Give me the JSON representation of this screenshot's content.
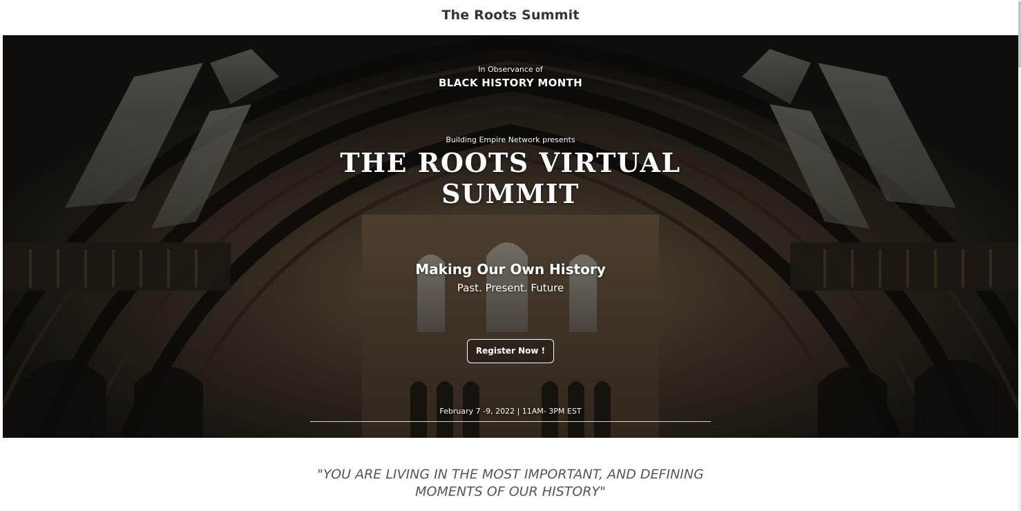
{
  "header": {
    "site_title": "The Roots Summit"
  },
  "hero": {
    "observance_pre": "In Observance of",
    "observance_main": "BLACK HISTORY MONTH",
    "presenter": "Building Empire Network presents",
    "title_line1": "THE ROOTS VIRTUAL",
    "title_line2": "SUMMIT",
    "tagline": "Making Our Own History",
    "tagline_sub": "Past. Present. Future",
    "register_label": "Register Now !",
    "event_date": "February 7 -9, 2022 | 11AM- 3PM EST"
  },
  "quote": {
    "line1": "\"YOU ARE LIVING IN THE MOST IMPORTANT, AND DEFINING",
    "line2": "MOMENTS OF OUR HISTORY\""
  },
  "colors": {
    "hero_dark": "#1b1712",
    "hero_brick": "#5a4a38",
    "quote_text": "#555555",
    "title_text": "#333333"
  },
  "icons": {
    "hero_background": "cathedral-hall-image"
  }
}
